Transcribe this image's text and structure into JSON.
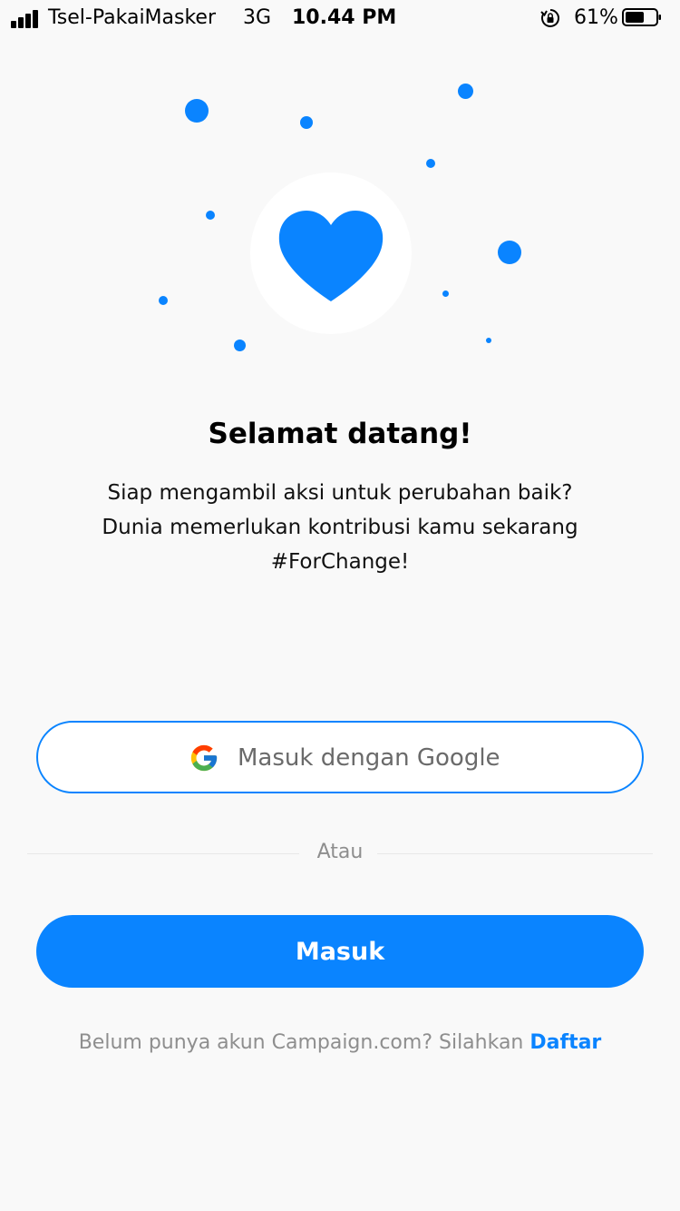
{
  "status_bar": {
    "carrier": "Tsel-PakaiMasker",
    "network": "3G",
    "time": "10.44 PM",
    "battery_percent": "61%",
    "battery_level": 0.61
  },
  "hero": {
    "icon": "heart-icon",
    "accent_color": "#0a84ff"
  },
  "welcome": {
    "title": "Selamat datang!",
    "line1": "Siap mengambil aksi untuk perubahan baik?",
    "line2": "Dunia memerlukan kontribusi kamu sekarang",
    "line3": "#ForChange!"
  },
  "google_button": {
    "label": "Masuk dengan Google",
    "icon": "google-icon"
  },
  "divider": {
    "label": "Atau"
  },
  "login_button": {
    "label": "Masuk"
  },
  "footer": {
    "prompt": "Belum punya akun Campaign.com? Silahkan",
    "signup_link": "Daftar"
  }
}
